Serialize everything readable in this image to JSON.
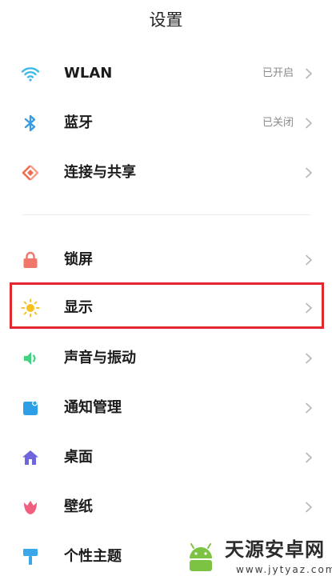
{
  "header": {
    "title": "设置"
  },
  "sections": {
    "connectivity": [
      {
        "id": "wlan",
        "label": "WLAN",
        "status": "已开启",
        "icon": "wifi-icon",
        "icon_color": "#3fb8e6"
      },
      {
        "id": "bluetooth",
        "label": "蓝牙",
        "status": "已关闭",
        "icon": "bluetooth-icon",
        "icon_color": "#3a9be5"
      },
      {
        "id": "connection-sharing",
        "label": "连接与共享",
        "status": "",
        "icon": "connection-share-icon",
        "icon_color": "#ee6e50"
      }
    ],
    "device": [
      {
        "id": "lock-screen",
        "label": "锁屏",
        "icon": "lock-icon",
        "icon_color": "#f0786a"
      },
      {
        "id": "display",
        "label": "显示",
        "icon": "sun-icon",
        "icon_color": "#f7c11e",
        "highlighted": true
      },
      {
        "id": "sound-vibration",
        "label": "声音与振动",
        "icon": "speaker-icon",
        "icon_color": "#3ed382"
      },
      {
        "id": "notifications",
        "label": "通知管理",
        "icon": "notification-icon",
        "icon_color": "#2c9fe6"
      },
      {
        "id": "home-screen",
        "label": "桌面",
        "icon": "home-icon",
        "icon_color": "#6f66dc"
      },
      {
        "id": "wallpaper",
        "label": "壁纸",
        "icon": "tulip-icon",
        "icon_color": "#f0607e"
      },
      {
        "id": "themes",
        "label": "个性主题",
        "icon": "paint-roller-icon",
        "icon_color": "#3aa7e8"
      }
    ]
  },
  "colors": {
    "highlight_border": "#e0282e",
    "chevron": "#b5b5b5",
    "status_text": "#8a8a8a"
  },
  "watermark": {
    "brand": "天源安卓网",
    "url": "www.jytyaz.com"
  }
}
